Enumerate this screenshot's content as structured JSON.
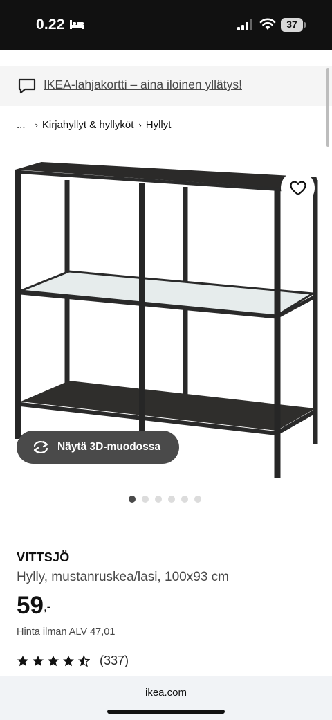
{
  "status_bar": {
    "time": "0.22",
    "battery": "37",
    "icons": [
      "bed-icon",
      "signal-icon",
      "wifi-icon",
      "battery-icon"
    ]
  },
  "promo": {
    "icon": "chat-icon",
    "text": "IKEA-lahjakortti – aina iloinen yllätys!"
  },
  "breadcrumb": {
    "items": [
      "...",
      "Kirjahyllyt & hyllyköt",
      "Hyllyt"
    ]
  },
  "gallery": {
    "view_3d_label": "Näytä 3D-muodossa",
    "favorite_icon": "heart-icon",
    "page_count": 6,
    "active_page": 1
  },
  "product": {
    "name": "VITTSJÖ",
    "description": "Hylly, mustanruskea/lasi, ",
    "dimensions": "100x93 cm",
    "price_whole": "59",
    "price_suffix": ",-",
    "vat_text": "Hinta ilman ALV 47,01",
    "rating": 4.5,
    "rating_max": 5,
    "rating_count": "(337)"
  },
  "browser": {
    "url": "ikea.com"
  },
  "colors": {
    "status_bar_bg": "#111111",
    "promo_bg": "#f5f5f5",
    "button_3d_bg": "#4a4a4a",
    "text_secondary": "#484848"
  }
}
